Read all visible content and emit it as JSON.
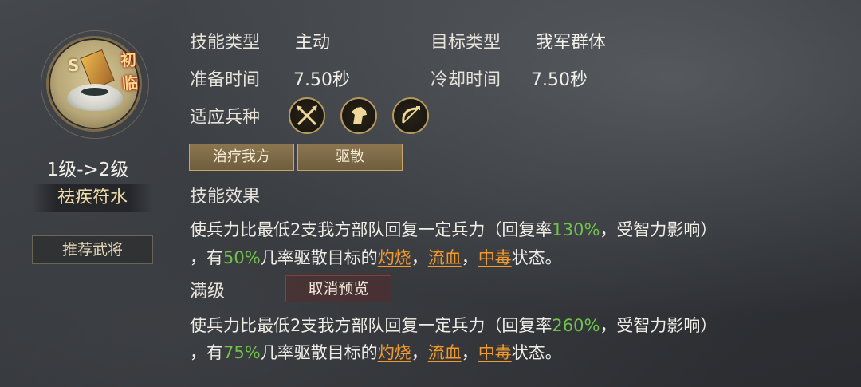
{
  "skill": {
    "grade": "S",
    "tag": "初临",
    "level": "1级->2级",
    "name": "祛疾符水"
  },
  "recommend_label": "推荐武将",
  "info": {
    "skill_type_label": "技能类型",
    "skill_type_value": "主动",
    "target_type_label": "目标类型",
    "target_type_value": "我军群体",
    "prep_time_label": "准备时间",
    "prep_time_value": "7.50秒",
    "cooldown_label": "冷却时间",
    "cooldown_value": "7.50秒",
    "troop_label": "适应兵种"
  },
  "troop_icons": [
    "crossed-spears-icon",
    "horse-head-icon",
    "bow-icon"
  ],
  "effect_tags": [
    "治疗我方",
    "驱散"
  ],
  "effect_title": "技能效果",
  "current": {
    "line1_a": "使兵力比最低2支我方部队回复一定兵力（回复率",
    "rate": "130%",
    "line1_b": "，受智力影响）",
    "line2_a": "，有",
    "chance": "50%",
    "line2_b": "几率驱散目标的",
    "burn": "灼烧",
    "sep1": "，",
    "bleed": "流血",
    "sep2": "，",
    "poison": "中毒",
    "line2_c": "状态。"
  },
  "max_label": "满级",
  "cancel_preview_label": "取消预览",
  "max": {
    "line1_a": "使兵力比最低2支我方部队回复一定兵力（回复率",
    "rate": "260%",
    "line1_b": "，受智力影响）",
    "line2_a": "，有",
    "chance": "75%",
    "line2_b": "几率驱散目标的",
    "burn": "灼烧",
    "sep1": "，",
    "bleed": "流血",
    "sep2": "，",
    "poison": "中毒",
    "line2_c": "状态。"
  },
  "colors": {
    "accent_green": "#6fc24e",
    "status_orange": "#f29a2b",
    "gold": "#c7a767"
  }
}
